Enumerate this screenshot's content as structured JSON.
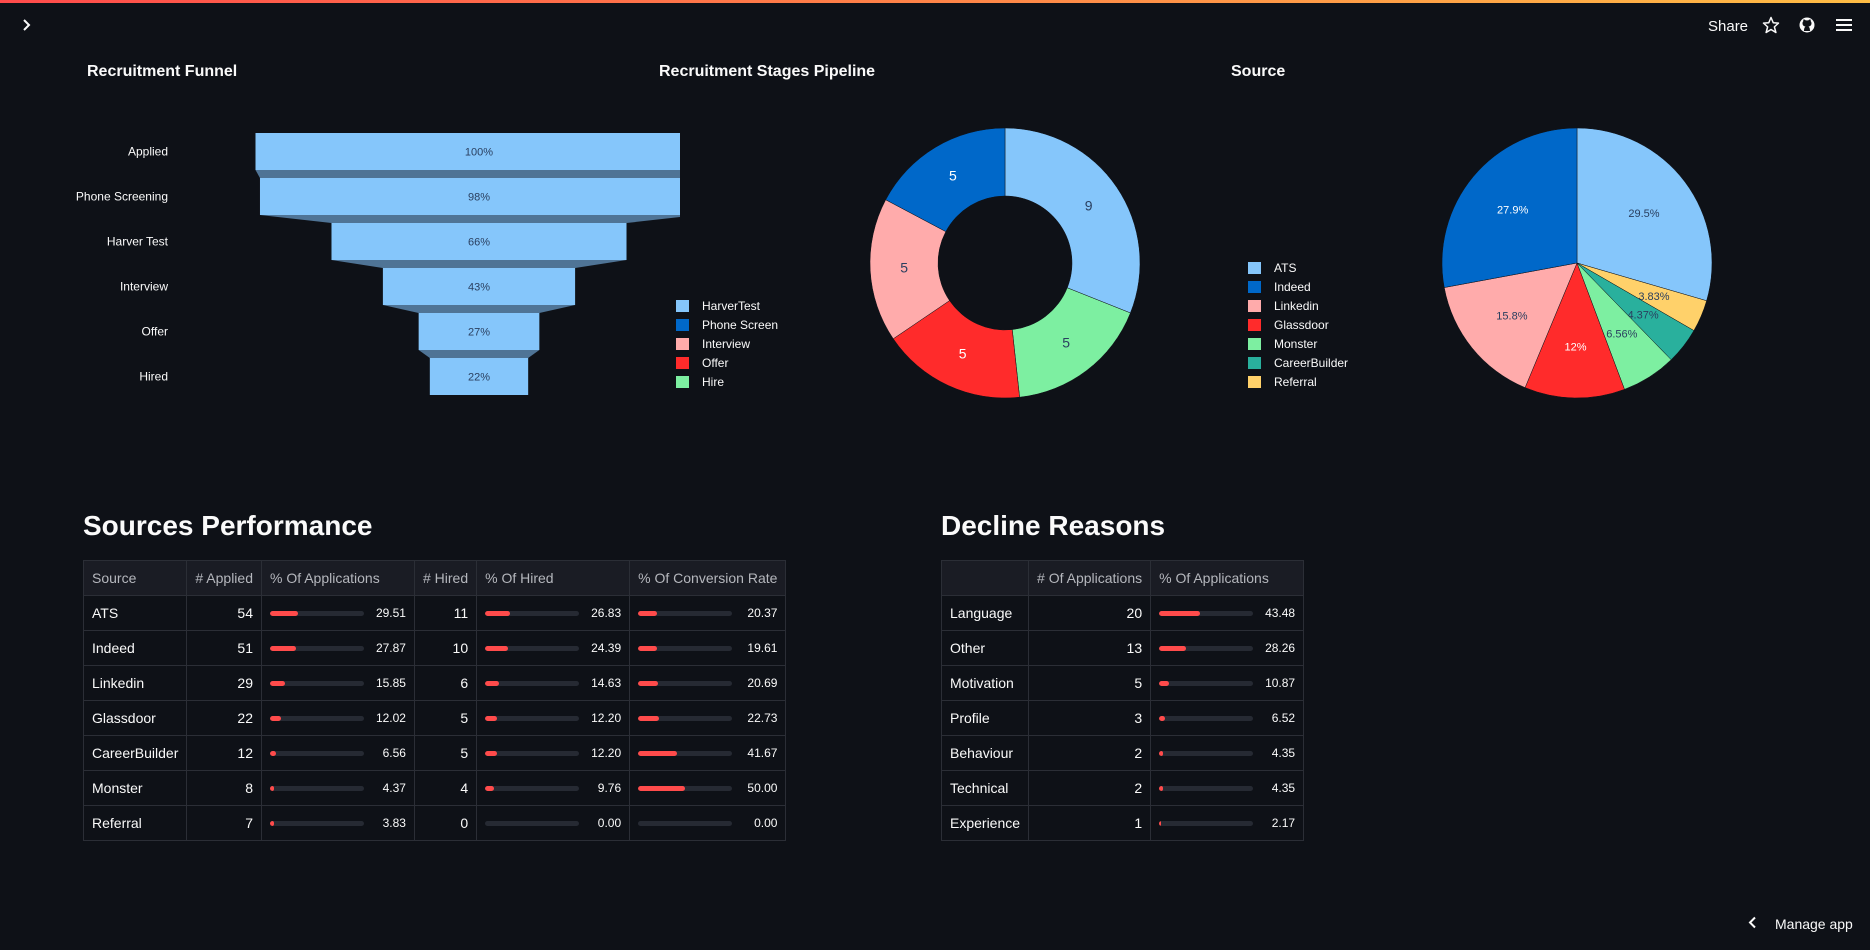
{
  "header": {
    "share_label": "Share",
    "icons": [
      "sidebar-expand-icon",
      "star-icon",
      "github-icon",
      "hamburger-menu-icon"
    ]
  },
  "funnel": {
    "title": "Recruitment Funnel",
    "color": "#85c6fb",
    "chart_data": {
      "type": "funnel",
      "categories": [
        "Applied",
        "Phone Screening",
        "Harver Test",
        "Interview",
        "Offer",
        "Hired"
      ],
      "values": [
        100,
        98,
        66,
        43,
        27,
        22
      ],
      "labels": [
        "100%",
        "98%",
        "66%",
        "43%",
        "27%",
        "22%"
      ]
    }
  },
  "pipeline": {
    "title": "Recruitment Stages Pipeline",
    "chart_data": {
      "type": "pie",
      "hole": true,
      "categories": [
        "HarverTest",
        "Phone Screen",
        "Interview",
        "Offer",
        "Hire"
      ],
      "legend_order": [
        "HarverTest",
        "Phone Screen",
        "Interview",
        "Offer",
        "Hire"
      ],
      "values": [
        9,
        5,
        5,
        5,
        5
      ],
      "colors": [
        "#85c6fb",
        "#0068c9",
        "#ffabab",
        "#ff2b2b",
        "#7defa1"
      ],
      "slice_order": [
        0,
        4,
        3,
        2,
        1
      ],
      "labels": [
        "9",
        "5",
        "5",
        "5",
        "5"
      ]
    }
  },
  "source": {
    "title": "Source",
    "chart_data": {
      "type": "pie",
      "categories": [
        "ATS",
        "Indeed",
        "Linkedin",
        "Glassdoor",
        "Monster",
        "CareerBuilder",
        "Referral"
      ],
      "values": [
        29.5,
        27.9,
        15.8,
        12,
        6.56,
        4.37,
        3.83
      ],
      "labels": [
        "29.5%",
        "27.9%",
        "15.8%",
        "12%",
        "6.56%",
        "4.37%",
        "3.83%"
      ],
      "colors": [
        "#85c6fb",
        "#0068c9",
        "#ffabab",
        "#ff2b2b",
        "#7defa1",
        "#29b09d",
        "#ffd16a"
      ],
      "slice_order": [
        0,
        6,
        5,
        4,
        3,
        2,
        1
      ]
    }
  },
  "sources_performance": {
    "title": "Sources Performance",
    "columns": [
      "Source",
      "# Applied",
      "% Of Applications",
      "# Hired",
      "% Of Hired",
      "% Of Conversion Rate"
    ],
    "rows": [
      {
        "source": "ATS",
        "applied": "54",
        "pct_app": "29.51",
        "hired": "11",
        "pct_hired": "26.83",
        "conv": "20.37"
      },
      {
        "source": "Indeed",
        "applied": "51",
        "pct_app": "27.87",
        "hired": "10",
        "pct_hired": "24.39",
        "conv": "19.61"
      },
      {
        "source": "Linkedin",
        "applied": "29",
        "pct_app": "15.85",
        "hired": "6",
        "pct_hired": "14.63",
        "conv": "20.69"
      },
      {
        "source": "Glassdoor",
        "applied": "22",
        "pct_app": "12.02",
        "hired": "5",
        "pct_hired": "12.20",
        "conv": "22.73"
      },
      {
        "source": "CareerBuilder",
        "applied": "12",
        "pct_app": "6.56",
        "hired": "5",
        "pct_hired": "12.20",
        "conv": "41.67"
      },
      {
        "source": "Monster",
        "applied": "8",
        "pct_app": "4.37",
        "hired": "4",
        "pct_hired": "9.76",
        "conv": "50.00"
      },
      {
        "source": "Referral",
        "applied": "7",
        "pct_app": "3.83",
        "hired": "0",
        "pct_hired": "0.00",
        "conv": "0.00"
      }
    ]
  },
  "decline_reasons": {
    "title": "Decline Reasons",
    "columns": [
      "",
      "# Of Applications",
      "% Of Applications"
    ],
    "rows": [
      {
        "reason": "Language",
        "count": "20",
        "pct": "43.48"
      },
      {
        "reason": "Other",
        "count": "13",
        "pct": "28.26"
      },
      {
        "reason": "Motivation",
        "count": "5",
        "pct": "10.87"
      },
      {
        "reason": "Profile",
        "count": "3",
        "pct": "6.52"
      },
      {
        "reason": "Behaviour",
        "count": "2",
        "pct": "4.35"
      },
      {
        "reason": "Technical",
        "count": "2",
        "pct": "4.35"
      },
      {
        "reason": "Experience",
        "count": "1",
        "pct": "2.17"
      }
    ]
  },
  "footer": {
    "manage_label": "Manage app"
  }
}
